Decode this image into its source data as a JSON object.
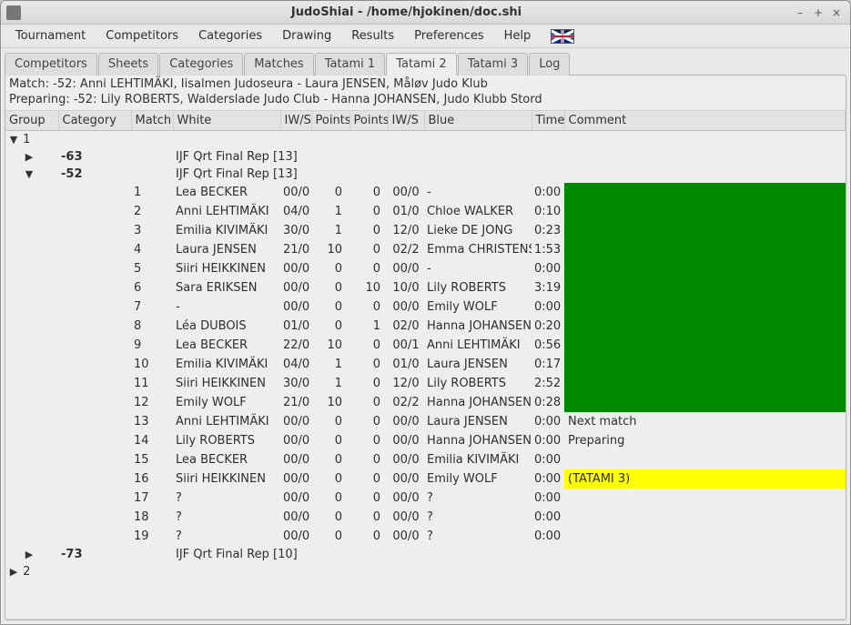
{
  "window": {
    "title": "JudoShiai - /home/hjokinen/doc.shi",
    "min": "–",
    "max": "+",
    "close": "×"
  },
  "menubar": [
    "Tournament",
    "Competitors",
    "Categories",
    "Drawing",
    "Results",
    "Preferences",
    "Help"
  ],
  "tabs": [
    "Competitors",
    "Sheets",
    "Categories",
    "Matches",
    "Tatami 1",
    "Tatami 2",
    "Tatami 3",
    "Log"
  ],
  "active_tab": "Tatami 2",
  "info1": "Match: -52: Anni LEHTIMÄKI, Iisalmen Judoseura - Laura JENSEN, Måløv Judo Klub",
  "info2": "Preparing: -52: Lily ROBERTS, Walderslade Judo Club - Hanna JOHANSEN, Judo Klubb Stord",
  "columns": [
    "Group",
    "Category",
    "Match",
    "White",
    "IW/S",
    "Points",
    "Points",
    "IW/S",
    "Blue",
    "Time",
    "Comment"
  ],
  "groups": {
    "g1": {
      "exp": "▼",
      "label": "1"
    },
    "g2": {
      "exp": "▶",
      "label": "2"
    }
  },
  "cats": {
    "c63": {
      "exp": "▶",
      "label": "-63",
      "desc": "IJF Qrt Final Rep [13]"
    },
    "c52": {
      "exp": "▼",
      "label": "-52",
      "desc": "IJF Qrt Final Rep [13]"
    },
    "c73": {
      "exp": "▶",
      "label": "-73",
      "desc": "IJF Qrt Final Rep [10]"
    }
  },
  "rows": [
    {
      "m": "1",
      "white": "Lea BECKER",
      "iws1": "00/0",
      "p1": "0",
      "p2": "0",
      "iws2": "00/0",
      "blue": "-",
      "time": "0:00",
      "cmt": "",
      "ccls": "cmt-green"
    },
    {
      "m": "2",
      "white": "Anni LEHTIMÄKI",
      "iws1": "04/0",
      "p1": "1",
      "p2": "0",
      "iws2": "01/0",
      "blue": "Chloe WALKER",
      "time": "0:10",
      "cmt": "",
      "ccls": "cmt-green"
    },
    {
      "m": "3",
      "white": "Emilia KIVIMÄKI",
      "iws1": "30/0",
      "p1": "1",
      "p2": "0",
      "iws2": "12/0",
      "blue": "Lieke DE JONG",
      "time": "0:23",
      "cmt": "",
      "ccls": "cmt-green"
    },
    {
      "m": "4",
      "white": "Laura JENSEN",
      "iws1": "21/0",
      "p1": "10",
      "p2": "0",
      "iws2": "02/2",
      "blue": "Emma CHRISTENSEN",
      "time": "1:53",
      "cmt": "",
      "ccls": "cmt-green"
    },
    {
      "m": "5",
      "white": "Siiri HEIKKINEN",
      "iws1": "00/0",
      "p1": "0",
      "p2": "0",
      "iws2": "00/0",
      "blue": "-",
      "time": "0:00",
      "cmt": "",
      "ccls": "cmt-green"
    },
    {
      "m": "6",
      "white": "Sara ERIKSEN",
      "iws1": "00/0",
      "p1": "0",
      "p2": "10",
      "iws2": "10/0",
      "blue": "Lily ROBERTS",
      "time": "3:19",
      "cmt": "",
      "ccls": "cmt-green"
    },
    {
      "m": "7",
      "white": "-",
      "iws1": "00/0",
      "p1": "0",
      "p2": "0",
      "iws2": "00/0",
      "blue": "Emily WOLF",
      "time": "0:00",
      "cmt": "",
      "ccls": "cmt-green"
    },
    {
      "m": "8",
      "white": "Léa DUBOIS",
      "iws1": "01/0",
      "p1": "0",
      "p2": "1",
      "iws2": "02/0",
      "blue": "Hanna JOHANSEN",
      "time": "0:20",
      "cmt": "",
      "ccls": "cmt-green"
    },
    {
      "m": "9",
      "white": "Lea BECKER",
      "iws1": "22/0",
      "p1": "10",
      "p2": "0",
      "iws2": "00/1",
      "blue": "Anni LEHTIMÄKI",
      "time": "0:56",
      "cmt": "",
      "ccls": "cmt-green"
    },
    {
      "m": "10",
      "white": "Emilia KIVIMÄKI",
      "iws1": "04/0",
      "p1": "1",
      "p2": "0",
      "iws2": "01/0",
      "blue": "Laura JENSEN",
      "time": "0:17",
      "cmt": "",
      "ccls": "cmt-green"
    },
    {
      "m": "11",
      "white": "Siiri HEIKKINEN",
      "iws1": "30/0",
      "p1": "1",
      "p2": "0",
      "iws2": "12/0",
      "blue": "Lily ROBERTS",
      "time": "2:52",
      "cmt": "",
      "ccls": "cmt-green"
    },
    {
      "m": "12",
      "white": "Emily WOLF",
      "iws1": "21/0",
      "p1": "10",
      "p2": "0",
      "iws2": "02/2",
      "blue": "Hanna JOHANSEN",
      "time": "0:28",
      "cmt": "",
      "ccls": "cmt-green"
    },
    {
      "m": "13",
      "white": "Anni LEHTIMÄKI",
      "iws1": "00/0",
      "p1": "0",
      "p2": "0",
      "iws2": "00/0",
      "blue": "Laura JENSEN",
      "time": "0:00",
      "cmt": "Next match",
      "ccls": ""
    },
    {
      "m": "14",
      "white": "Lily ROBERTS",
      "iws1": "00/0",
      "p1": "0",
      "p2": "0",
      "iws2": "00/0",
      "blue": "Hanna JOHANSEN",
      "time": "0:00",
      "cmt": "Preparing",
      "ccls": ""
    },
    {
      "m": "15",
      "white": "Lea BECKER",
      "iws1": "00/0",
      "p1": "0",
      "p2": "0",
      "iws2": "00/0",
      "blue": "Emilia KIVIMÄKI",
      "time": "0:00",
      "cmt": "",
      "ccls": ""
    },
    {
      "m": "16",
      "white": "Siiri HEIKKINEN",
      "iws1": "00/0",
      "p1": "0",
      "p2": "0",
      "iws2": "00/0",
      "blue": "Emily WOLF",
      "time": "0:00",
      "cmt": "(TATAMI 3)",
      "ccls": "cmt-yellow"
    },
    {
      "m": "17",
      "white": "?",
      "iws1": "00/0",
      "p1": "0",
      "p2": "0",
      "iws2": "00/0",
      "blue": "?",
      "time": "0:00",
      "cmt": "",
      "ccls": ""
    },
    {
      "m": "18",
      "white": "?",
      "iws1": "00/0",
      "p1": "0",
      "p2": "0",
      "iws2": "00/0",
      "blue": "?",
      "time": "0:00",
      "cmt": "",
      "ccls": ""
    },
    {
      "m": "19",
      "white": "?",
      "iws1": "00/0",
      "p1": "0",
      "p2": "0",
      "iws2": "00/0",
      "blue": "?",
      "time": "0:00",
      "cmt": "",
      "ccls": ""
    }
  ]
}
